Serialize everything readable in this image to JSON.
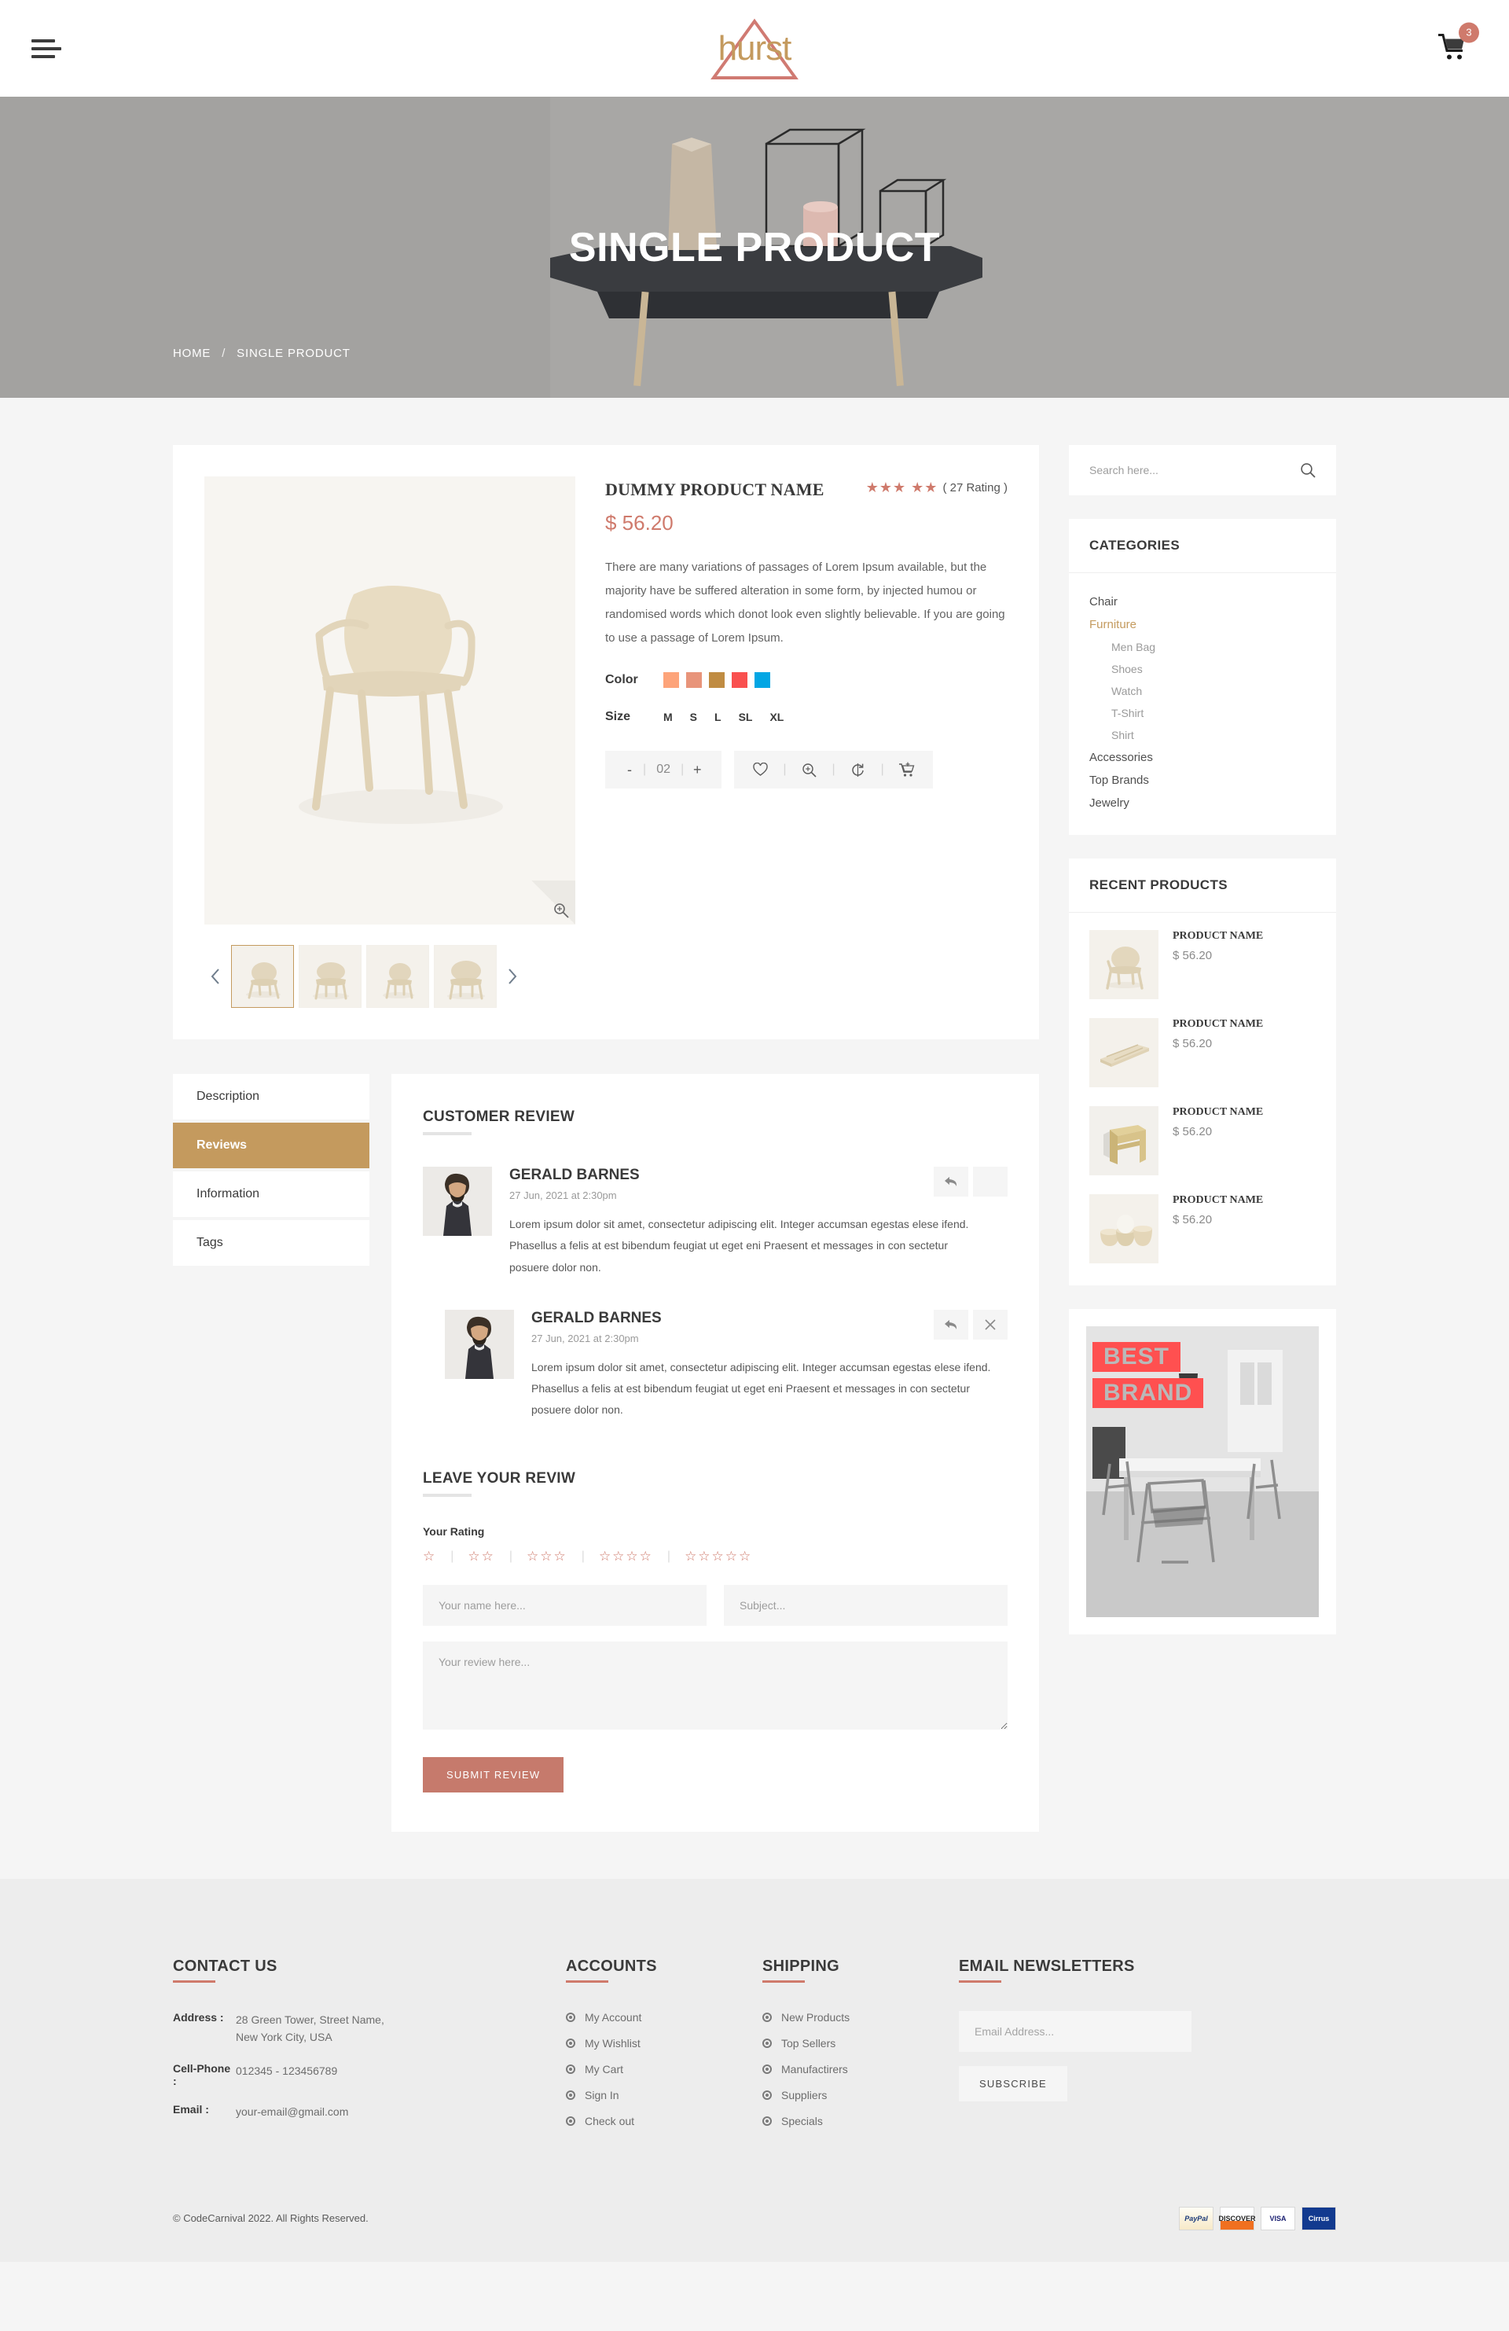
{
  "header": {
    "menu_icon": "hamburger-menu-icon",
    "logo_text": "hurst",
    "cart_icon": "shopping-cart-icon",
    "cart_count": "3"
  },
  "hero": {
    "title": "SINGLE PRODUCT",
    "breadcrumb_home": "HOME",
    "breadcrumb_sep": "/",
    "breadcrumb_current": "SINGLE PRODUCT"
  },
  "product": {
    "name": "DUMMY PRODUCT NAME",
    "price": "$ 56.20",
    "rating_stars": "★★★",
    "rating_half": "★★",
    "rating_count": "( 27 Rating )",
    "description": "There are many variations of passages of Lorem Ipsum available, but the majority have be suffered alteration in some form, by injected humou or randomised words which donot look even slightly believable. If you are going to use a passage of Lorem Ipsum.",
    "color_label": "Color",
    "colors": [
      "#fda47a",
      "#e8947a",
      "#c08c42",
      "#f9504f",
      "#02a6e4"
    ],
    "size_label": "Size",
    "sizes": [
      "M",
      "S",
      "L",
      "SL",
      "XL"
    ],
    "qty_minus": "-",
    "qty_value": "02",
    "qty_plus": "+",
    "actions": [
      "wishlist-icon",
      "quickview-icon",
      "compare-icon",
      "add-to-cart-icon"
    ],
    "zoom_icon": "zoom-in-icon",
    "prev_arrow": "chevron-left-icon",
    "next_arrow": "chevron-right-icon"
  },
  "tabs": [
    {
      "label": "Description",
      "active": false
    },
    {
      "label": "Reviews",
      "active": true
    },
    {
      "label": "Information",
      "active": false
    },
    {
      "label": "Tags",
      "active": false
    }
  ],
  "reviews_section": {
    "title": "CUSTOMER REVIEW",
    "items": [
      {
        "name": "GERALD BARNES",
        "date": "27 Jun, 2021 at 2:30pm",
        "text": "Lorem ipsum dolor sit amet, consectetur adipiscing elit. Integer accumsan egestas elese ifend. Phasellus a felis at est bibendum feugiat ut eget eni Praesent et messages in con sectetur posuere dolor non.",
        "reply_icon": "reply-icon",
        "close_icon": "close-icon"
      },
      {
        "name": "GERALD BARNES",
        "date": "27 Jun, 2021 at 2:30pm",
        "text": "Lorem ipsum dolor sit amet, consectetur adipiscing elit. Integer accumsan egestas elese ifend. Phasellus a felis at est bibendum feugiat ut eget eni Praesent et messages in con sectetur posuere dolor non.",
        "reply_icon": "reply-icon",
        "close_icon": "close-icon"
      }
    ]
  },
  "leave_review": {
    "title": "LEAVE YOUR REVIW",
    "rating_label": "Your Rating",
    "rating_groups": [
      "☆",
      "☆☆",
      "☆☆☆",
      "☆☆☆☆",
      "☆☆☆☆☆"
    ],
    "name_placeholder": "Your name here...",
    "subject_placeholder": "Subject...",
    "review_placeholder": "Your review here...",
    "submit_label": "SUBMIT REVIEW"
  },
  "sidebar": {
    "search_placeholder": "Search here...",
    "search_icon": "search-icon",
    "categories_title": "CATEGORIES",
    "categories": [
      {
        "label": "Chair",
        "sub": false,
        "active": false
      },
      {
        "label": "Furniture",
        "sub": false,
        "active": true
      },
      {
        "label": "Men Bag",
        "sub": true,
        "active": false
      },
      {
        "label": "Shoes",
        "sub": true,
        "active": false
      },
      {
        "label": "Watch",
        "sub": true,
        "active": false
      },
      {
        "label": "T-Shirt",
        "sub": true,
        "active": false
      },
      {
        "label": "Shirt",
        "sub": true,
        "active": false
      },
      {
        "label": "Accessories",
        "sub": false,
        "active": false
      },
      {
        "label": "Top Brands",
        "sub": false,
        "active": false
      },
      {
        "label": "Jewelry",
        "sub": false,
        "active": false
      }
    ],
    "recent_title": "RECENT PRODUCTS",
    "recent_products": [
      {
        "name": "PRODUCT NAME",
        "price": "$ 56.20",
        "thumb": "chair-thumb"
      },
      {
        "name": "PRODUCT NAME",
        "price": "$ 56.20",
        "thumb": "tray-thumb"
      },
      {
        "name": "PRODUCT NAME",
        "price": "$ 56.20",
        "thumb": "stool-thumb"
      },
      {
        "name": "PRODUCT NAME",
        "price": "$ 56.20",
        "thumb": "bowls-thumb"
      }
    ],
    "promo": {
      "line1": "BEST",
      "line2": "BRAND"
    }
  },
  "footer": {
    "contact": {
      "title": "CONTACT US",
      "address_key": "Address :",
      "address_val": "28 Green Tower, Street Name,\nNew York City, USA",
      "phone_key": "Cell-Phone :",
      "phone_val": "012345 - 123456789",
      "email_key": "Email :",
      "email_val": "your-email@gmail.com"
    },
    "accounts": {
      "title": "ACCOUNTS",
      "links": [
        "My Account",
        "My Wishlist",
        "My Cart",
        "Sign In",
        "Check out"
      ]
    },
    "shipping": {
      "title": "SHIPPING",
      "links": [
        "New Products",
        "Top Sellers",
        "Manufactirers",
        "Suppliers",
        "Specials"
      ]
    },
    "newsletter": {
      "title": "EMAIL NEWSLETTERS",
      "placeholder": "Email Address...",
      "button": "SUBSCRIBE"
    },
    "copyright": "© CodeCarnival 2022. All Rights Reserved.",
    "payments": [
      "PayPal",
      "DISCOVER",
      "VISA",
      "Cirrus"
    ]
  }
}
